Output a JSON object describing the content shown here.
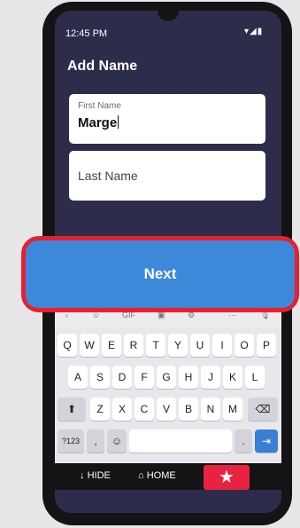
{
  "status_bar": {
    "time": "12:45 PM",
    "icons": "▾◢▮"
  },
  "screen": {
    "title": "Add Name"
  },
  "first_name": {
    "label": "First Name",
    "value": "Marge"
  },
  "last_name": {
    "placeholder": "Last Name"
  },
  "next_button": {
    "label": "Next"
  },
  "suggestion_bar": [
    "‹",
    "☺",
    "GIF",
    "▣",
    "⚙",
    "⋯",
    "🎙"
  ],
  "keyboard": {
    "row1": [
      "Q",
      "W",
      "E",
      "R",
      "T",
      "Y",
      "U",
      "I",
      "O",
      "P"
    ],
    "row2": [
      "A",
      "S",
      "D",
      "F",
      "G",
      "H",
      "J",
      "K",
      "L"
    ],
    "row3": [
      "Z",
      "X",
      "C",
      "V",
      "B",
      "N",
      "M"
    ],
    "shift": "⬆",
    "backspace": "⌫",
    "symbols": "?123",
    "comma": ",",
    "emoji": "☺",
    "period": ".",
    "enter": "⇥"
  },
  "bottom_nav": {
    "hide": "HIDE",
    "home": "HOME",
    "star": "★"
  },
  "colors": {
    "accent_red": "#e7202f",
    "button_blue": "#3d88d8",
    "screen_bg": "#2d2d4b"
  }
}
